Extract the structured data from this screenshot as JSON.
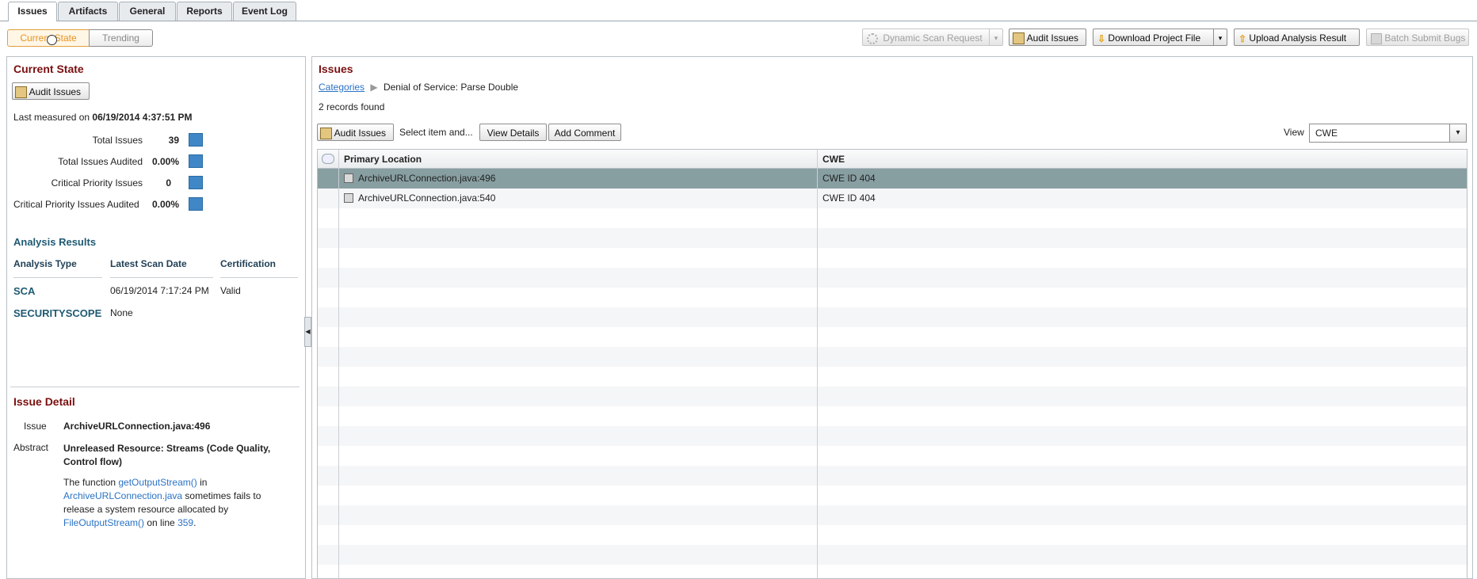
{
  "tabs": [
    "Issues",
    "Artifacts",
    "General",
    "Reports",
    "Event Log"
  ],
  "view_toggle": [
    "Current State",
    "Trending"
  ],
  "toolbar": {
    "dynamic_scan": "Dynamic Scan Request",
    "audit_issues": "Audit Issues",
    "download_project": "Download Project File",
    "upload_analysis": "Upload Analysis Result",
    "batch_submit": "Batch Submit Bugs"
  },
  "current_state": {
    "title": "Current State",
    "audit_btn": "Audit Issues",
    "last_measured_prefix": "Last measured on",
    "last_measured_value": "06/19/2014 4:37:51 PM",
    "metrics": [
      {
        "label": "Total Issues",
        "value": "39"
      },
      {
        "label": "Total Issues Audited",
        "value": "0.00%"
      },
      {
        "label": "Critical Priority Issues",
        "value": "0"
      },
      {
        "label": "Critical Priority Issues Audited",
        "value": "0.00%"
      }
    ]
  },
  "analysis": {
    "title": "Analysis Results",
    "headers": [
      "Analysis Type",
      "Latest Scan Date",
      "Certification"
    ],
    "rows": [
      {
        "type": "SCA",
        "date": "06/19/2014 7:17:24 PM",
        "cert": "Valid"
      },
      {
        "type": "SECURITYSCOPE",
        "date": "None",
        "cert": ""
      }
    ]
  },
  "issue_detail": {
    "title": "Issue Detail",
    "issue_label": "Issue",
    "issue_value": "ArchiveURLConnection.java:496",
    "abstract_label": "Abstract",
    "abstract_value": "Unreleased Resource: Streams (Code Quality, Control flow)",
    "desc": {
      "p1": "The function ",
      "l1": "getOutputStream()",
      "p2": " in ",
      "l2": "ArchiveURLConnection.java",
      "p3": " sometimes fails to release a system resource allocated by ",
      "l3": "FileOutputStream()",
      "p4": " on line ",
      "l4": "359",
      "p5": "."
    }
  },
  "issues": {
    "title": "Issues",
    "breadcrumb_link": "Categories",
    "breadcrumb_current": "Denial of Service: Parse Double",
    "records_found": "2 records found",
    "audit_btn": "Audit Issues",
    "select_text": "Select item and...",
    "view_details": "View Details",
    "add_comment": "Add Comment",
    "view_label": "View",
    "view_value": "CWE",
    "columns": [
      "Primary Location",
      "CWE"
    ],
    "rows": [
      {
        "location": "ArchiveURLConnection.java:496",
        "cwe": "CWE ID 404"
      },
      {
        "location": "ArchiveURLConnection.java:540",
        "cwe": "CWE ID 404"
      }
    ]
  },
  "colors": {
    "accent_orange": "#e8921b",
    "heading_red": "#7a0f0f",
    "selected_row": "#889fa2"
  }
}
